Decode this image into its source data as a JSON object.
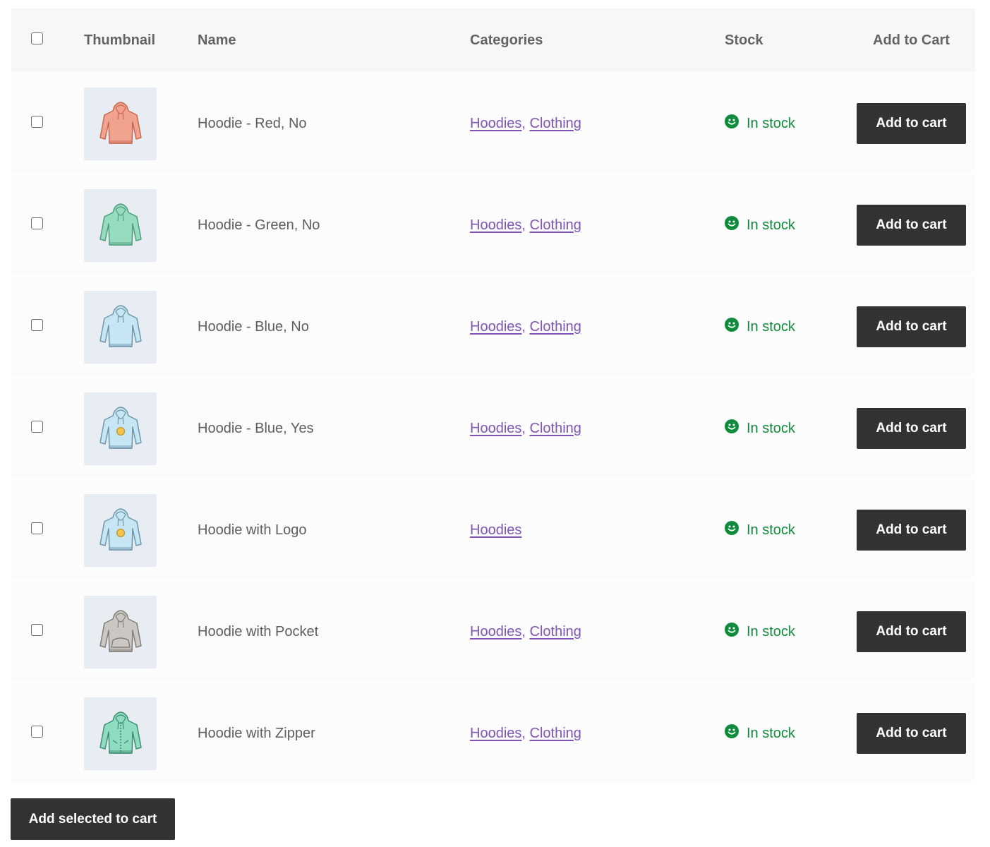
{
  "table": {
    "headers": {
      "thumbnail": "Thumbnail",
      "name": "Name",
      "categories": "Categories",
      "stock": "Stock",
      "add_to_cart": "Add to Cart"
    },
    "rows": [
      {
        "name": "Hoodie - Red, No",
        "categories": [
          "Hoodies",
          "Clothing"
        ],
        "stock": "In stock",
        "button": "Add to cart",
        "hoodie_color": "#f2a38f",
        "hoodie_stroke": "#c8694f",
        "style": "plain"
      },
      {
        "name": "Hoodie - Green, No",
        "categories": [
          "Hoodies",
          "Clothing"
        ],
        "stock": "In stock",
        "button": "Add to cart",
        "hoodie_color": "#98dcc0",
        "hoodie_stroke": "#4f9d7d",
        "style": "plain"
      },
      {
        "name": "Hoodie - Blue, No",
        "categories": [
          "Hoodies",
          "Clothing"
        ],
        "stock": "In stock",
        "button": "Add to cart",
        "hoodie_color": "#c6e6f3",
        "hoodie_stroke": "#6e97aa",
        "style": "plain"
      },
      {
        "name": "Hoodie - Blue, Yes",
        "categories": [
          "Hoodies",
          "Clothing"
        ],
        "stock": "In stock",
        "button": "Add to cart",
        "hoodie_color": "#c6e6f3",
        "hoodie_stroke": "#6e97aa",
        "style": "logo"
      },
      {
        "name": "Hoodie with Logo",
        "categories": [
          "Hoodies"
        ],
        "stock": "In stock",
        "button": "Add to cart",
        "hoodie_color": "#c6e6f3",
        "hoodie_stroke": "#6e97aa",
        "style": "logo"
      },
      {
        "name": "Hoodie with Pocket",
        "categories": [
          "Hoodies",
          "Clothing"
        ],
        "stock": "In stock",
        "button": "Add to cart",
        "hoodie_color": "#cbc8c3",
        "hoodie_stroke": "#817d77",
        "style": "pocket"
      },
      {
        "name": "Hoodie with Zipper",
        "categories": [
          "Hoodies",
          "Clothing"
        ],
        "stock": "In stock",
        "button": "Add to cart",
        "hoodie_color": "#8fdcc0",
        "hoodie_stroke": "#3f8e72",
        "style": "zipper"
      }
    ]
  },
  "footer": {
    "bulk_button": "Add selected to cart"
  },
  "colors": {
    "link": "#7f54b3",
    "in_stock": "#0f8a3a",
    "button_bg": "#333333"
  }
}
